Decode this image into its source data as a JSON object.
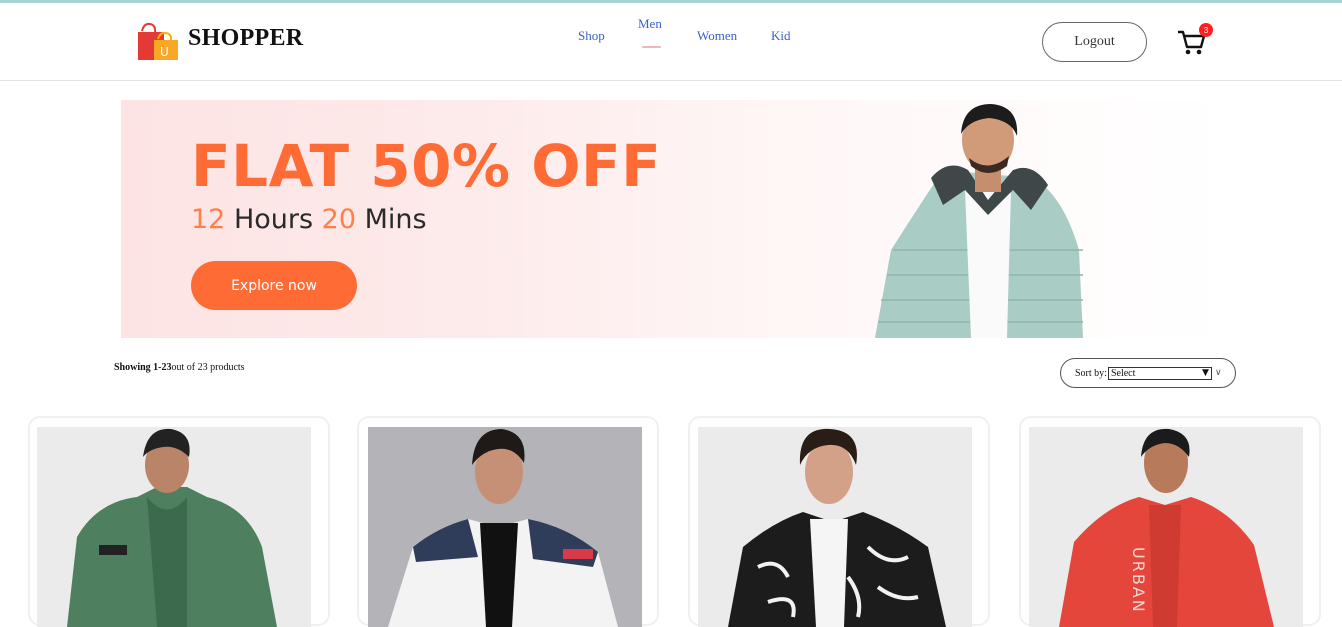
{
  "header": {
    "brand": "SHOPPER",
    "nav": [
      "Shop",
      "Men",
      "Women",
      "Kid"
    ],
    "active_nav": "Men",
    "logout_label": "Logout",
    "cart_count": "3"
  },
  "banner": {
    "title": "FLAT 50% OFF",
    "sub_hours_num": "12",
    "sub_hours_word": " Hours ",
    "sub_mins_num": "20",
    "sub_mins_word": " Mins",
    "cta_label": "Explore now"
  },
  "listing": {
    "showing_bold": "Showing 1-23",
    "showing_rest": "out of 23 products",
    "sort_label": "Sort by:",
    "sort_value": "Select"
  },
  "products": [
    {
      "name": "green hooded zip jacket",
      "color": "#4e7f5e"
    },
    {
      "name": "navy white red puffer jacket",
      "color": "#f2f2f2"
    },
    {
      "name": "black white printed bomber jacket",
      "color": "#1a1a1a"
    },
    {
      "name": "red hooded jacket",
      "color": "#e4463b"
    }
  ],
  "colors": {
    "accent": "#ff6b35",
    "nav_link": "#3a5fd0",
    "badge": "#ff1f1f"
  }
}
